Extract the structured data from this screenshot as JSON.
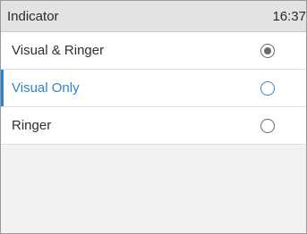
{
  "header": {
    "title": "Indicator",
    "time": "16:37"
  },
  "options": [
    {
      "label": "Visual & Ringer",
      "checked": true,
      "focused": false
    },
    {
      "label": "Visual Only",
      "checked": false,
      "focused": true
    },
    {
      "label": "Ringer",
      "checked": false,
      "focused": false
    }
  ],
  "colors": {
    "accent": "#2f83c4",
    "header_bg": "#e3e3e3",
    "text": "#2f2f2f"
  }
}
